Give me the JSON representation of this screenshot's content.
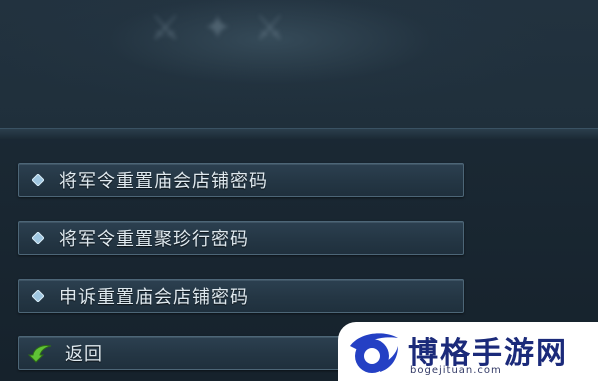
{
  "menu": {
    "items": [
      {
        "label": "将军令重置庙会店铺密码",
        "icon": "diamond-bullet-icon"
      },
      {
        "label": "将军令重置聚珍行密码",
        "icon": "diamond-bullet-icon"
      },
      {
        "label": "申诉重置庙会店铺密码",
        "icon": "diamond-bullet-icon"
      }
    ],
    "back": {
      "label": "返回",
      "icon": "green-back-arrow-icon"
    }
  },
  "watermark": {
    "name": "博格手游网",
    "url": "bogejituan.com"
  },
  "colors": {
    "background": "#1a2833",
    "item_border": "#4d6677",
    "item_text": "#dfe9ef",
    "bullet": "#9fc6e0",
    "back_arrow": "#5fc236",
    "watermark_text": "#1b2a7a"
  }
}
